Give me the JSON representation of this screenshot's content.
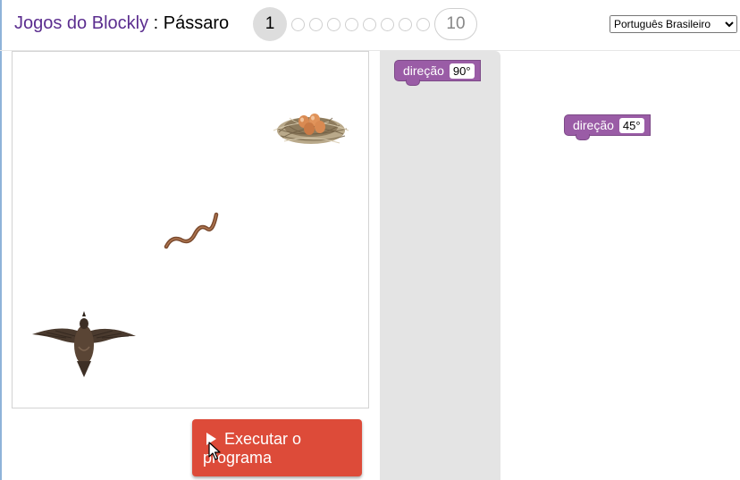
{
  "header": {
    "app_title": "Jogos do Blockly",
    "separator": " : ",
    "game_title": "Pássaro",
    "current_level": "1",
    "last_level": "10",
    "language": "Português Brasileiro",
    "language_options": [
      "Português Brasileiro"
    ]
  },
  "run_button": {
    "label_line1": "Executar o",
    "label_line2": "programa"
  },
  "flyout": {
    "block": {
      "label": "direção",
      "value": "90°"
    }
  },
  "workspace": {
    "block": {
      "label": "direção",
      "value": "45°"
    }
  },
  "colors": {
    "block": "#9a5ca6",
    "run_button": "#dd4b39",
    "title": "#5b2d8f",
    "flyout_bg": "#e4e4e4"
  }
}
